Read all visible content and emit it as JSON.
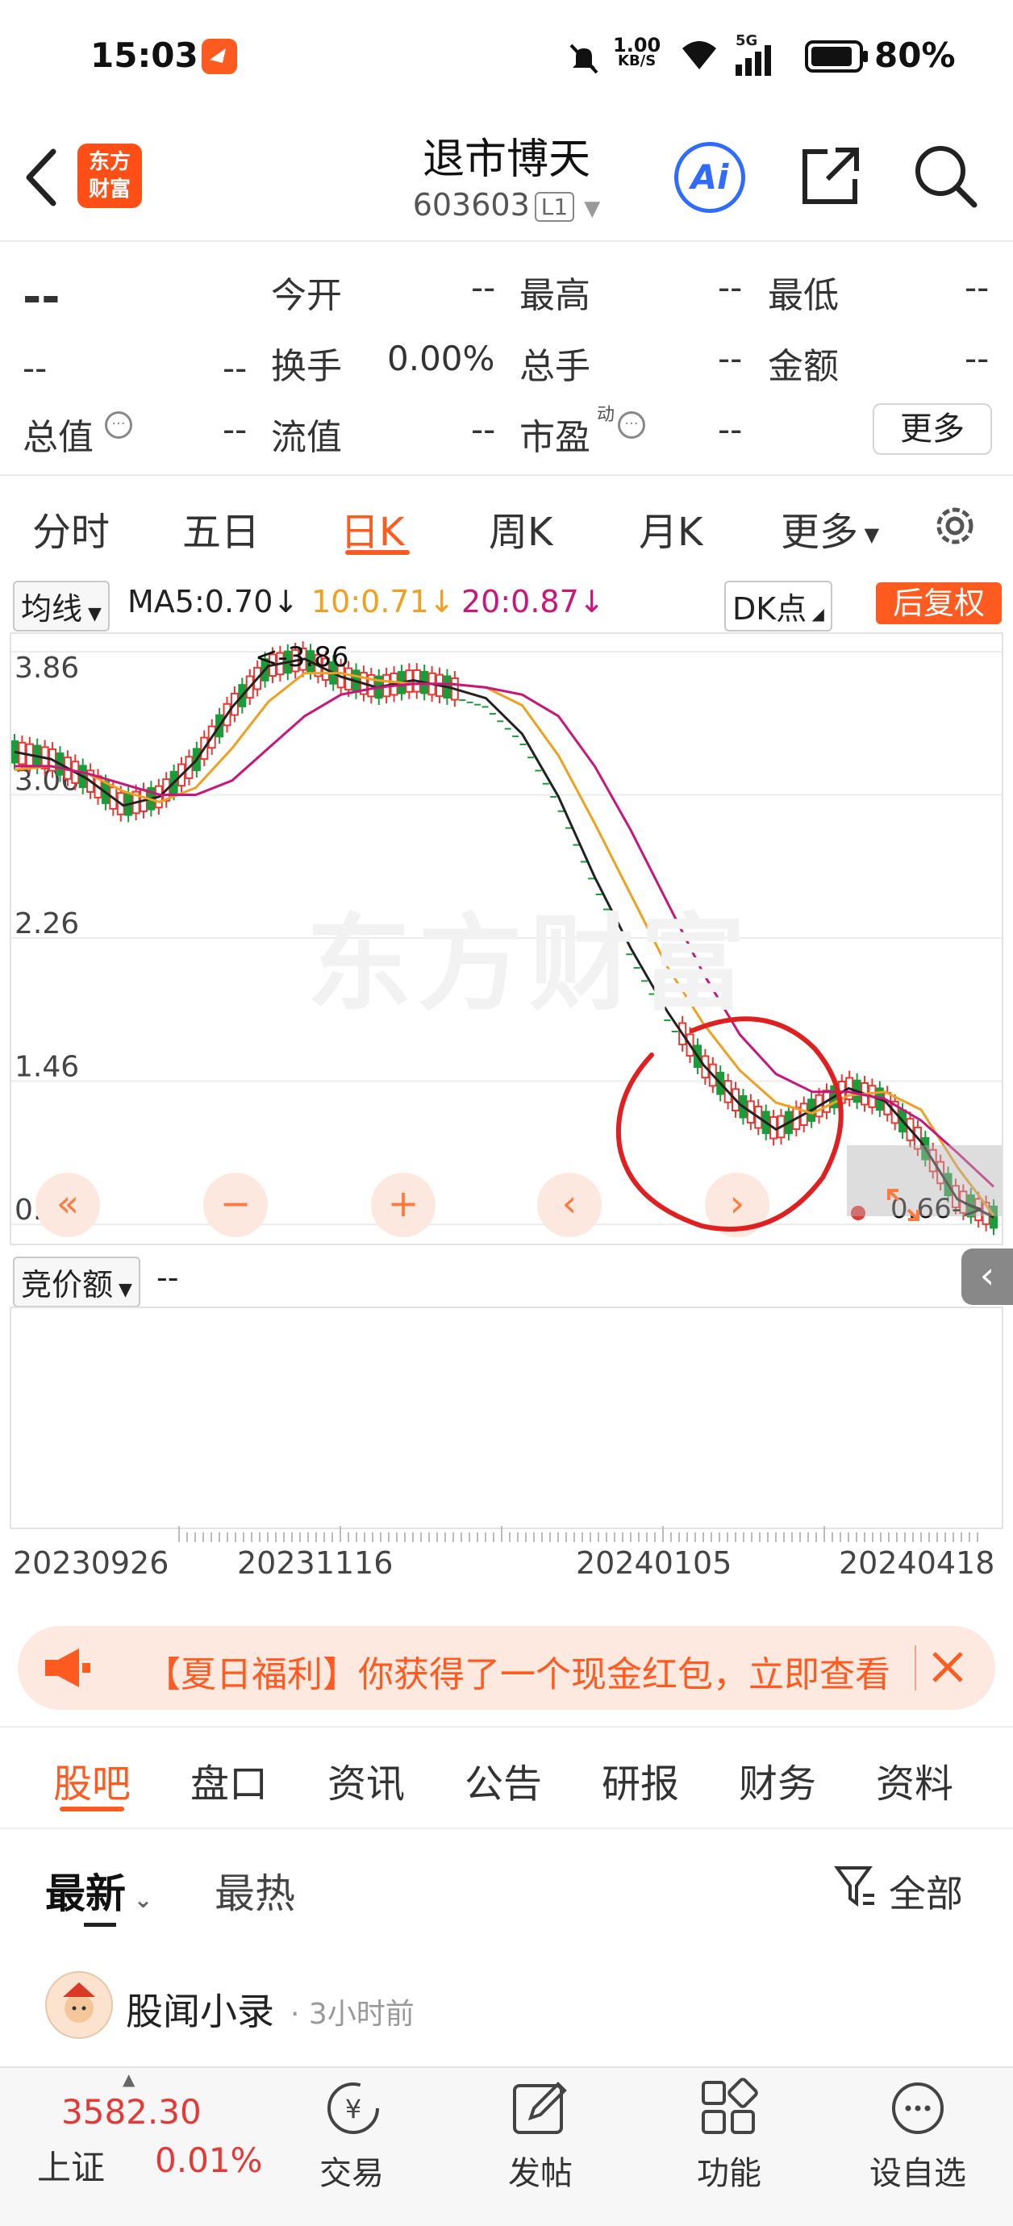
{
  "status_bar": {
    "time": "15:03",
    "net_speed_value": "1.00",
    "net_speed_unit": "KB/S",
    "signal_label": "5G",
    "battery": "80%"
  },
  "header": {
    "logo_text_1": "东方",
    "logo_text_2": "财富",
    "stock_name": "退市博天",
    "stock_code": "603603",
    "level_badge": "L1",
    "ai_label": "Ai"
  },
  "quote": {
    "price": "--",
    "change": "--",
    "change_pct": "--",
    "open_label": "今开",
    "open_value": "--",
    "high_label": "最高",
    "high_value": "--",
    "low_label": "最低",
    "low_value": "--",
    "turnover_label": "换手",
    "turnover_value": "0.00%",
    "volume_label": "总手",
    "volume_value": "--",
    "amount_label": "金额",
    "amount_value": "--",
    "mktcap_label": "总值",
    "mktcap_value": "--",
    "float_label": "流值",
    "float_value": "--",
    "pe_label": "市盈",
    "pe_sup": "动",
    "pe_value": "--",
    "more_label": "更多"
  },
  "chart_tabs": [
    "分时",
    "五日",
    "日K",
    "周K",
    "月K",
    "更多"
  ],
  "active_chart_tab": "日K",
  "ma_row": {
    "indicator_select": "均线",
    "ma5": "MA5:0.70",
    "ma10": "10:0.71",
    "ma20": "20:0.87",
    "arrow": "↓",
    "dk_label": "DK点",
    "adjust_label": "后复权"
  },
  "colors": {
    "accent": "#ff5a1f",
    "ma5": "#222222",
    "ma10": "#f0a020",
    "ma20": "#c8167a",
    "rise": "#e53935",
    "fall": "#1a9c3a",
    "circle": "#e02020"
  },
  "watermark": "东方财富",
  "chart_data": {
    "type": "candlestick",
    "y_ticks": [
      "3.86",
      "3.06",
      "2.26",
      "1.46",
      "0.66"
    ],
    "ylim": [
      0.66,
      3.86
    ],
    "high_marker": "<-3.86",
    "low_marker": "0.66->",
    "x_ticks": [
      "20230926",
      "20231116",
      "20240105",
      "20240418"
    ],
    "series": [
      {
        "name": "MA5",
        "values": [
          3.3,
          3.26,
          3.15,
          3.0,
          3.05,
          3.25,
          3.55,
          3.78,
          3.82,
          3.72,
          3.66,
          3.7,
          3.66,
          3.6,
          3.4,
          3.05,
          2.6,
          2.2,
          1.85,
          1.55,
          1.33,
          1.19,
          1.3,
          1.42,
          1.35,
          1.12,
          0.8,
          0.7
        ]
      },
      {
        "name": "10",
        "values": [
          3.2,
          3.22,
          3.18,
          3.08,
          3.02,
          3.1,
          3.32,
          3.58,
          3.74,
          3.74,
          3.7,
          3.68,
          3.68,
          3.66,
          3.56,
          3.28,
          2.9,
          2.5,
          2.1,
          1.78,
          1.52,
          1.34,
          1.28,
          1.38,
          1.4,
          1.3,
          0.98,
          0.71
        ]
      },
      {
        "name": "20",
        "values": [
          3.22,
          3.22,
          3.18,
          3.12,
          3.06,
          3.06,
          3.14,
          3.32,
          3.5,
          3.62,
          3.66,
          3.68,
          3.68,
          3.66,
          3.62,
          3.5,
          3.22,
          2.86,
          2.46,
          2.06,
          1.72,
          1.5,
          1.4,
          1.4,
          1.36,
          1.24,
          1.06,
          0.87
        ]
      }
    ],
    "controls": [
      "«",
      "−",
      "+",
      "‹",
      "›"
    ]
  },
  "auction": {
    "label": "竞价额",
    "value": "--"
  },
  "banner": {
    "text": "【夏日福利】你获得了一个现金红包，立即查看"
  },
  "news_tabs": [
    "股吧",
    "盘口",
    "资讯",
    "公告",
    "研报",
    "财务",
    "资料"
  ],
  "active_news_tab": "股吧",
  "sort": {
    "latest": "最新",
    "hot": "最热",
    "filter": "全部"
  },
  "post": {
    "author": "股闻小录",
    "time": "3小时前"
  },
  "bottom_bar": {
    "index_value": "3582.30",
    "index_name": "上证",
    "index_change": "0.01%",
    "items": [
      "交易",
      "发帖",
      "功能",
      "设自选"
    ]
  }
}
